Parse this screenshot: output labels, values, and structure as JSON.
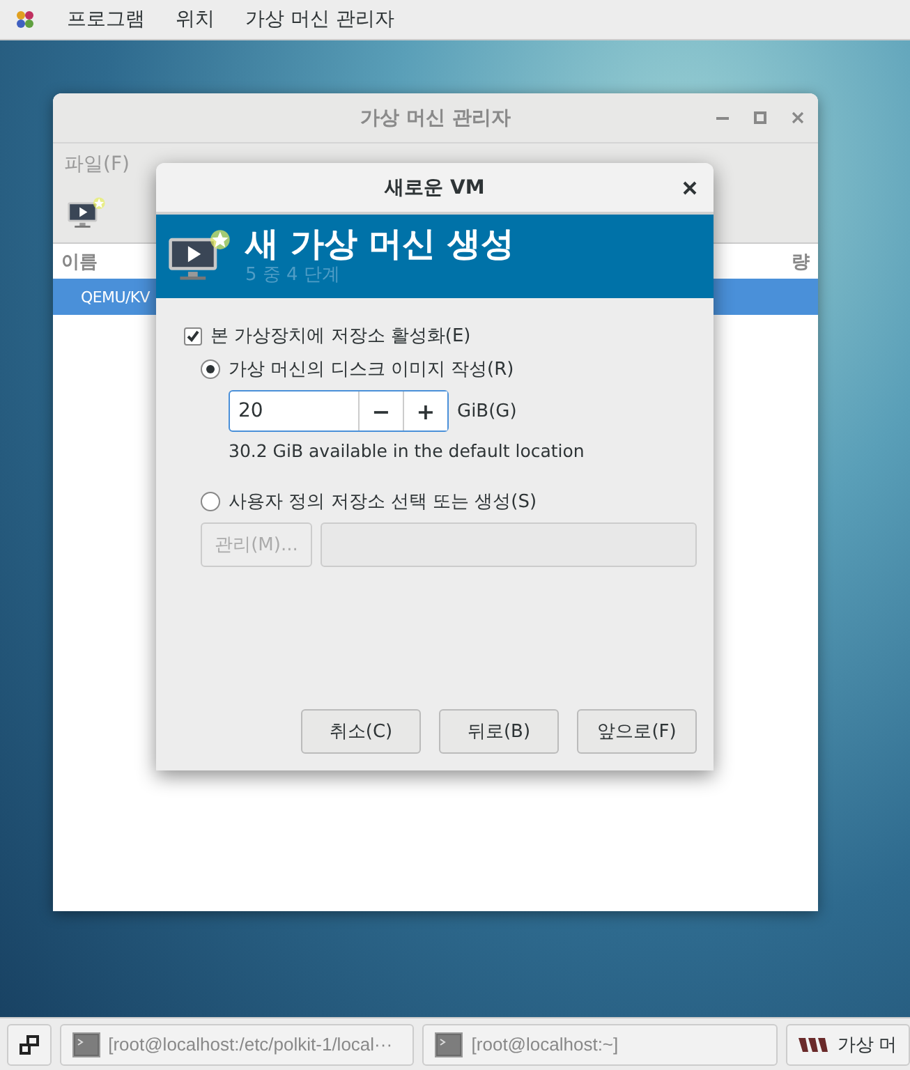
{
  "top_bar": {
    "menus": [
      "프로그램",
      "위치",
      "가상 머신 관리자"
    ]
  },
  "main_window": {
    "title": "가상 머신 관리자",
    "menus": [
      "파일(F)"
    ],
    "columns": [
      "이름",
      "량"
    ],
    "rows": [
      {
        "name": "QEMU/KV",
        "selected": true
      }
    ]
  },
  "dialog": {
    "title": "새로운 VM",
    "banner_title": "새 가상 머신 생성",
    "banner_step": "5 중 4 단계",
    "storage_checkbox": {
      "label": "본 가상장치에 저장소 활성화(E)",
      "checked": true
    },
    "options": [
      {
        "label": "가상 머신의 디스크 이미지 작성(R)",
        "selected": true
      },
      {
        "label": "사용자 정의 저장소 선택 또는 생성(S)",
        "selected": false
      }
    ],
    "size": {
      "value": "20",
      "minus": "−",
      "plus": "+",
      "unit": "GiB(G)"
    },
    "available": "30.2 GiB available in the default location",
    "manage_button": "관리(M)...",
    "buttons": [
      "취소(C)",
      "뒤로(B)",
      "앞으로(F)"
    ]
  },
  "taskbar": {
    "tasks": [
      "[root@localhost:/etc/polkit-1/local···",
      "[root@localhost:~]",
      "가상 머"
    ]
  }
}
